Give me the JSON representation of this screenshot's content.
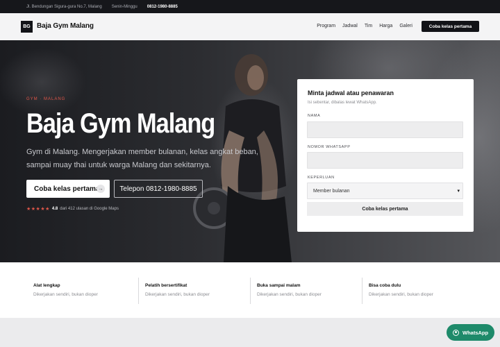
{
  "topbar": {
    "address": "Jl. Bendungan Sigura-gura No.7, Malang",
    "hours": "Senin-Minggu",
    "phone": "0812-1980-8885"
  },
  "header": {
    "logo_mark": "BG",
    "brand": "Baja Gym Malang",
    "nav": [
      "Program",
      "Jadwal",
      "Tim",
      "Harga",
      "Galeri"
    ],
    "cta": "Coba kelas pertama"
  },
  "hero": {
    "eyebrow": "GYM · MALANG",
    "title": "Baja Gym Malang",
    "subtitle": "Gym di Malang. Mengerjakan member bulanan, kelas angkat beban, sampai muay thai untuk warga Malang dan sekitarnya.",
    "primary_button": "Coba kelas pertama",
    "primary_button_icon": "arrow-right-icon",
    "secondary_button": "Telepon 0812-1980-8885",
    "rating": {
      "stars": "★★★★★",
      "score": "4.8",
      "text": "dari 412 ulasan di Google Maps"
    }
  },
  "form": {
    "title": "Minta jadwal atau penawaran",
    "note": "Isi sebentar, dibalas lewat WhatsApp.",
    "fields": [
      {
        "label": "NAMA",
        "value": ""
      },
      {
        "label": "NOMOR WHATSAPP",
        "value": ""
      },
      {
        "label": "KEPERLUAN",
        "value": "Member bulanan"
      }
    ],
    "submit": "Coba kelas pertama"
  },
  "features": [
    {
      "title": "Alat lengkap",
      "desc": "Dikerjakan sendiri, bukan dioper"
    },
    {
      "title": "Pelatih bersertifikat",
      "desc": "Dikerjakan sendiri, bukan dioper"
    },
    {
      "title": "Buka sampai malam",
      "desc": "Dikerjakan sendiri, bukan dioper"
    },
    {
      "title": "Bisa coba dulu",
      "desc": "Dikerjakan sendiri, bukan dioper"
    }
  ],
  "whatsapp": {
    "label": "WhatsApp",
    "icon": "whatsapp-icon"
  },
  "colors": {
    "accent": "#e0574a",
    "dark": "#121317",
    "whatsapp": "#1e8a6a"
  }
}
